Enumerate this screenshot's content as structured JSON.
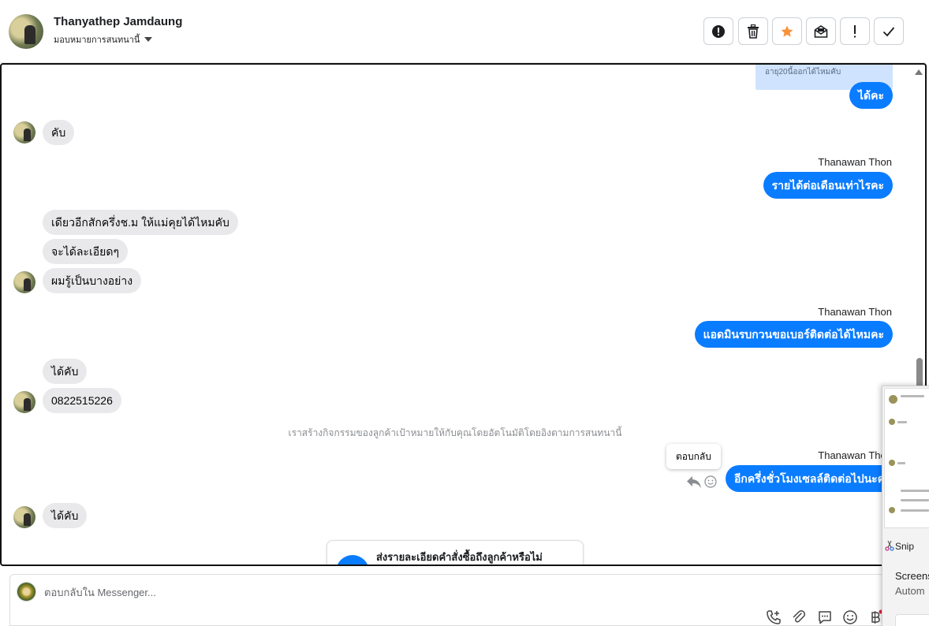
{
  "header": {
    "contact_name": "Thanyathep Jamdaung",
    "assign_label": "มอบหมายการสนทนานี้",
    "toolbar": [
      "alert-circle",
      "trash",
      "star",
      "mark-unread",
      "exclamation",
      "check"
    ],
    "colors": {
      "star": "#f7923a"
    }
  },
  "conversation": {
    "quoted_preview": "อายุ20นี้ออกได้ไหมคับ",
    "messages": [
      {
        "dir": "out",
        "text": "ได้คะ"
      },
      {
        "dir": "in",
        "text": "คับ"
      },
      {
        "dir": "out",
        "sender": "Thanawan Thon",
        "text": "รายได้ต่อเดือนเท่าไรคะ"
      },
      {
        "dir": "in",
        "text": "เดียวอีกสักครึ่งช.ม ให้แม่คุยได้ไหมคับ"
      },
      {
        "dir": "in",
        "text": "จะได้ละเอียดๆ"
      },
      {
        "dir": "in",
        "text": "ผมรู้เป็นบางอย่าง"
      },
      {
        "dir": "out",
        "sender": "Thanawan Thon",
        "text": "แอดมินรบกวนขอเบอร์ติดต่อได้ไหมคะ"
      },
      {
        "dir": "in",
        "text": "ได้คับ"
      },
      {
        "dir": "in",
        "text": "0822515226"
      },
      {
        "dir": "out",
        "sender": "Thanawan Thon",
        "text": "อีกครึ่งชั่วโมงเซลล์ติดต่อไปนะคะ"
      },
      {
        "dir": "in",
        "text": "ได้คับ"
      }
    ],
    "system_note": "เราสร้างกิจกรรมของลูกค้าเป้าหมายให้กับคุณโดยอัตโนมัติโดยอิงตามการสนทนานี้",
    "reply_tooltip": "ตอบกลับ",
    "card_prompt": "ส่งรายละเอียดคำสั่งซื้อถึงลูกค้าหรือไม่",
    "colors": {
      "outgoing": "#0a7cff",
      "incoming": "#e9e9eb"
    }
  },
  "composer": {
    "placeholder": "ตอบกลับใน Messenger...",
    "icons": [
      "phone-plus",
      "paperclip",
      "chat-bubble",
      "emoji",
      "baht"
    ]
  },
  "snip_overlay": {
    "app_name": "Snip",
    "line1": "Screens",
    "line2": "Autom"
  }
}
